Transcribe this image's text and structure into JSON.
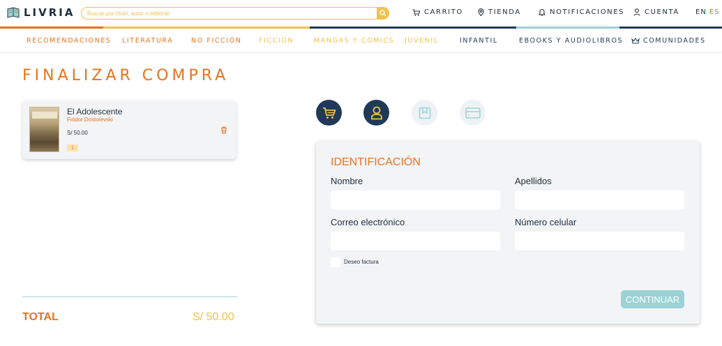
{
  "brand": {
    "name": "LIVRIA"
  },
  "search": {
    "placeholder": "Buscar por título, autor o editorial"
  },
  "topnav": {
    "cart": "CARRITO",
    "store": "TIENDA",
    "notifications": "NOTIFICACIONES",
    "account": "CUENTA",
    "lang_en": "EN",
    "lang_es": "ES"
  },
  "categories": [
    {
      "label": "RECOMENDACIONES",
      "color": "#e8731c"
    },
    {
      "label": "LITERATURA",
      "color": "#e8731c"
    },
    {
      "label": "NO FICCIÓN",
      "color": "#e8731c"
    },
    {
      "label": "FICCIÓN",
      "color": "#f2c14e"
    },
    {
      "label": "MANGAS Y COMICS",
      "color": "#f2c14e"
    },
    {
      "label": "JUVENIL",
      "color": "#f2c14e"
    },
    {
      "label": "INFANTIL",
      "color": "#1f3a56"
    },
    {
      "label": "EBOOKS Y AUDIOLIBROS",
      "color": "#1f3a56"
    },
    {
      "label": "COMUNIDADES",
      "color": "#1f3a56"
    }
  ],
  "colors": {
    "accent_orange": "#e8731c",
    "accent_yellow": "#f2c14e",
    "navy": "#1f3a56",
    "teal": "#9ad3d6"
  },
  "page": {
    "title": "FINALIZAR COMPRA"
  },
  "cart_item": {
    "title": "El Adolescente",
    "author": "Fiódor Dostoievski",
    "price": "S/ 50.00",
    "quantity": "1"
  },
  "total": {
    "label": "TOTAL",
    "value": "S/ 50.00"
  },
  "steps": [
    {
      "icon": "cart-icon",
      "state": "done"
    },
    {
      "icon": "user-icon",
      "state": "done"
    },
    {
      "icon": "bookmark-icon",
      "state": "pending"
    },
    {
      "icon": "credit-card-icon",
      "state": "pending"
    }
  ],
  "form": {
    "title": "IDENTIFICACIÓN",
    "first_name_label": "Nombre",
    "last_name_label": "Apellidos",
    "email_label": "Correo electrónico",
    "phone_label": "Número celular",
    "invoice_label": "Deseo factura",
    "continue_label": "CONTINUAR"
  }
}
